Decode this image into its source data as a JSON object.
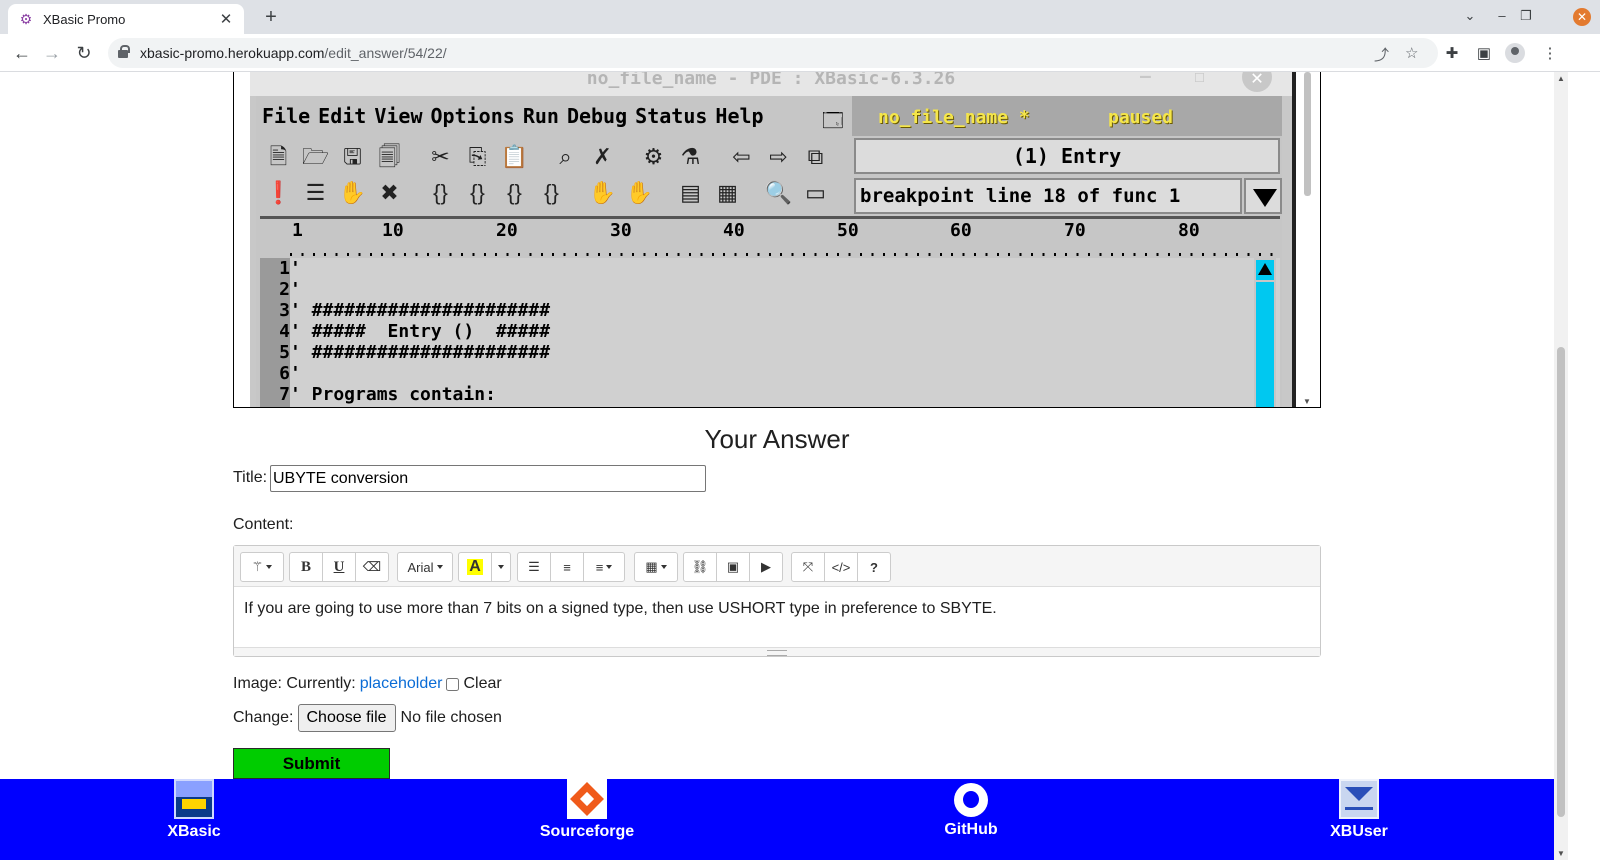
{
  "browser": {
    "tab_title": "XBasic Promo",
    "url_host": "xbasic-promo.herokuapp.com",
    "url_path": "/edit_answer/54/22/"
  },
  "ide_screenshot": {
    "window_title": "no_file_name - PDE : XBasic-6.3.26",
    "menu": [
      "File",
      "Edit",
      "View",
      "Options",
      "Run",
      "Debug",
      "Status",
      "Help"
    ],
    "status_filename": "no_file_name *",
    "status_state": "paused",
    "function_box": "(1) Entry",
    "breakpoint_box": "breakpoint line 18 of func 1",
    "ruler_first": "1",
    "ruler_numbers": [
      "10",
      "20",
      "30",
      "40",
      "50",
      "60",
      "70",
      "80"
    ],
    "code_lines": [
      {
        "n": "1",
        "text": "'"
      },
      {
        "n": "2",
        "text": "'"
      },
      {
        "n": "3",
        "text": "' ######################"
      },
      {
        "n": "4",
        "text": "' #####  Entry ()  #####"
      },
      {
        "n": "5",
        "text": "' ######################"
      },
      {
        "n": "6",
        "text": "'"
      },
      {
        "n": "7",
        "text": "' Programs contain:"
      }
    ]
  },
  "form": {
    "heading": "Your Answer",
    "title_label": "Title:",
    "title_value": "UBYTE conversion",
    "content_label": "Content:",
    "font_select": "Arial",
    "content_text": "If you are going to use more than 7 bits on a signed type, then use USHORT type in preference to SBYTE.",
    "image_label": "Image: Currently:",
    "image_link": "placeholder",
    "clear_label": "Clear",
    "change_label": "Change:",
    "choose_file_label": "Choose file",
    "no_file_text": "No file chosen",
    "submit_label": "Submit"
  },
  "footer": {
    "links": [
      {
        "label": "XBasic",
        "icon": "xbasic-logo-icon"
      },
      {
        "label": "Sourceforge",
        "icon": "sourceforge-logo-icon"
      },
      {
        "label": "GitHub",
        "icon": "github-logo-icon"
      },
      {
        "label": "XBUser",
        "icon": "mail-logo-icon"
      }
    ]
  },
  "colors": {
    "footer_bg": "#0000ff",
    "submit_bg": "#00cc00",
    "link": "#0a6cd6"
  }
}
